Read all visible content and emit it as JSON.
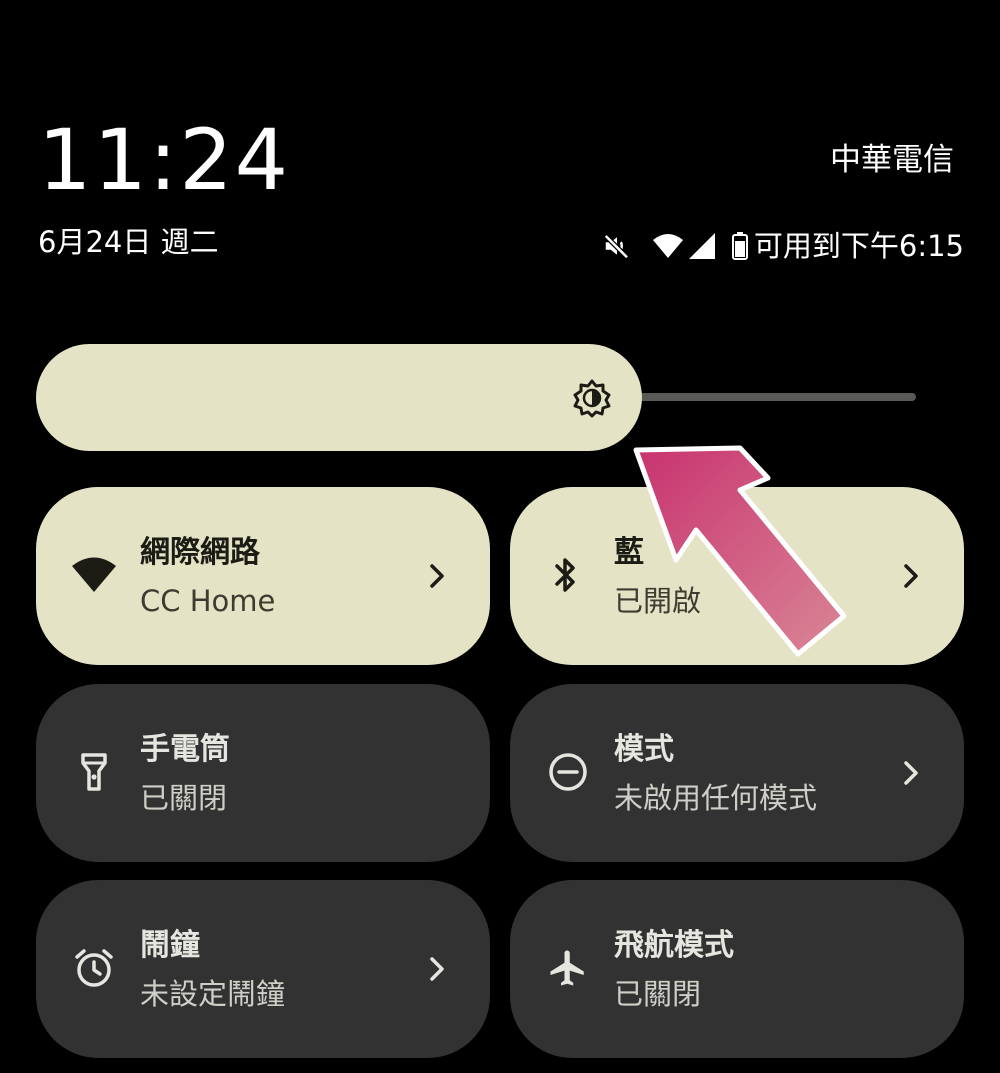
{
  "status_bar": {
    "time": "11:24",
    "date": "6月24日 週二",
    "carrier": "中華電信",
    "battery_text": "可用到下午6:15",
    "icons": [
      "mute-icon",
      "wifi-icon",
      "signal-icon",
      "battery-icon"
    ]
  },
  "brightness": {
    "level": 0.68,
    "icon": "brightness-icon"
  },
  "tiles": [
    {
      "title": "網際網路",
      "subtitle": "CC Home",
      "state": "on",
      "icon": "wifi-icon",
      "has_chevron": true
    },
    {
      "title": "藍",
      "subtitle": "已開啟",
      "state": "on",
      "icon": "bluetooth-icon",
      "has_chevron": true
    },
    {
      "title": "手電筒",
      "subtitle": "已關閉",
      "state": "off",
      "icon": "flashlight-icon",
      "has_chevron": false
    },
    {
      "title": "模式",
      "subtitle": "未啟用任何模式",
      "state": "off",
      "icon": "do-not-disturb-icon",
      "has_chevron": true
    },
    {
      "title": "鬧鐘",
      "subtitle": "未設定鬧鐘",
      "state": "off",
      "icon": "alarm-icon",
      "has_chevron": true
    },
    {
      "title": "飛航模式",
      "subtitle": "已關閉",
      "state": "off",
      "icon": "airplane-icon",
      "has_chevron": false
    }
  ],
  "colors": {
    "background": "#000000",
    "tile_on": "#e5e3c6",
    "tile_off": "#323232",
    "annotation_arrow": "#c8336f"
  }
}
